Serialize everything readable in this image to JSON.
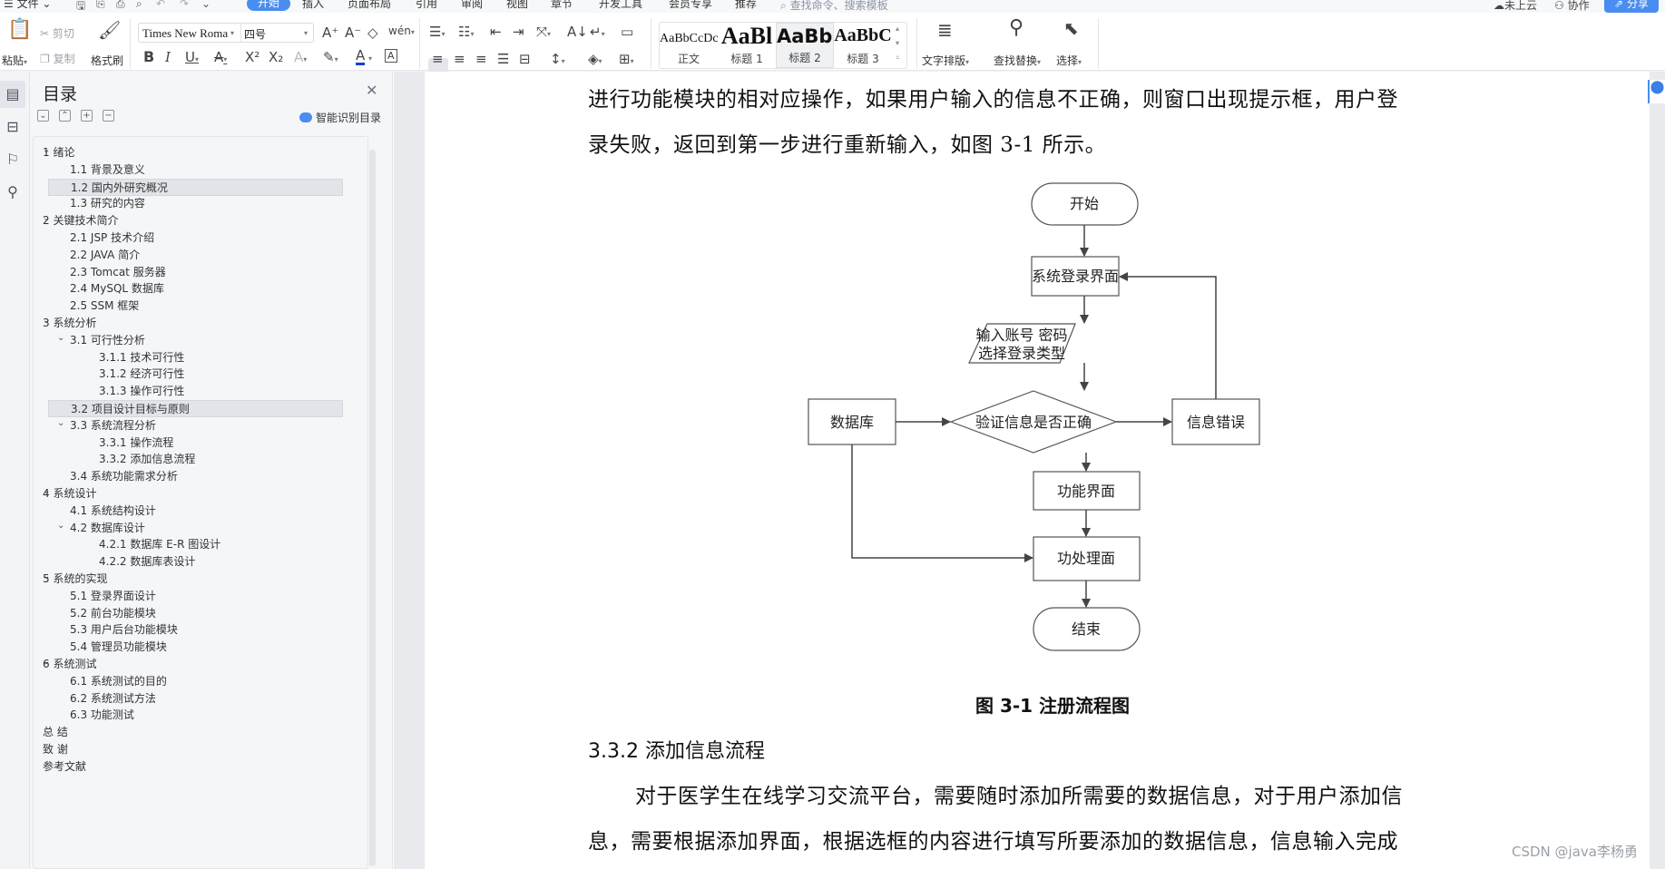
{
  "menubar": {
    "file_menu": "文件",
    "tabs": [
      "开始",
      "插入",
      "页面布局",
      "引用",
      "审阅",
      "视图",
      "章节",
      "开发工具",
      "会员专享",
      "推荐"
    ],
    "active_tab": "开始",
    "search_placeholder": "查找命令、搜索模板",
    "cloud_status": "未上云",
    "collaborate": "协作",
    "share": "分享"
  },
  "ribbon": {
    "paste": "粘贴",
    "cut": "剪切",
    "copy": "复制",
    "format_painter": "格式刷",
    "font_name": "Times New Roma",
    "font_size": "四号",
    "styles": [
      {
        "preview": "AaBbCcDc",
        "label": "正文"
      },
      {
        "preview": "AaBl",
        "label": "标题 1"
      },
      {
        "preview": "AaBb(",
        "label": "标题 2"
      },
      {
        "preview": "AaBbC",
        "label": "标题 3"
      }
    ],
    "selected_style": "标题 2",
    "text_layout": "文字排版",
    "find_replace": "查找替换",
    "select": "选择",
    "pinyin_glyph": "wén"
  },
  "toc": {
    "title": "目录",
    "smart_toc": "智能识别目录",
    "items": [
      {
        "level": 1,
        "label": "1  绪论",
        "expanded": true
      },
      {
        "level": 2,
        "label": "1.1 背景及意义"
      },
      {
        "level": 2,
        "label": "1.2  国内外研究概况",
        "highlighted": true
      },
      {
        "level": 2,
        "label": "1.3  研究的内容"
      },
      {
        "level": 1,
        "label": "2  关键技术简介",
        "expanded": true
      },
      {
        "level": 2,
        "label": "2.1 JSP 技术介绍"
      },
      {
        "level": 2,
        "label": "2.2 JAVA 简介"
      },
      {
        "level": 2,
        "label": "2.3 Tomcat 服务器"
      },
      {
        "level": 2,
        "label": "2.4 MySQL 数据库"
      },
      {
        "level": 2,
        "label": "2.5 SSM 框架"
      },
      {
        "level": 1,
        "label": "3  系统分析",
        "expanded": true
      },
      {
        "level": 2,
        "label": "3.1  可行性分析",
        "expanded": true
      },
      {
        "level": 3,
        "label": "3.1.1  技术可行性"
      },
      {
        "level": 3,
        "label": "3.1.2  经济可行性"
      },
      {
        "level": 3,
        "label": "3.1.3  操作可行性"
      },
      {
        "level": 2,
        "label": "3.2  项目设计目标与原则",
        "highlighted": true
      },
      {
        "level": 2,
        "label": "3.3  系统流程分析",
        "expanded": true
      },
      {
        "level": 3,
        "label": "3.3.1  操作流程"
      },
      {
        "level": 3,
        "label": "3.3.2  添加信息流程"
      },
      {
        "level": 2,
        "label": "3.4  系统功能需求分析"
      },
      {
        "level": 1,
        "label": "4  系统设计",
        "expanded": true
      },
      {
        "level": 2,
        "label": "4.1 系统结构设计"
      },
      {
        "level": 2,
        "label": "4.2 数据库设计",
        "expanded": true
      },
      {
        "level": 3,
        "label": "4.2.1  数据库 E-R 图设计"
      },
      {
        "level": 3,
        "label": "4.2.2  数据库表设计"
      },
      {
        "level": 1,
        "label": "5  系统的实现",
        "expanded": true
      },
      {
        "level": 2,
        "label": "5.1 登录界面设计"
      },
      {
        "level": 2,
        "label": "5.2 前台功能模块"
      },
      {
        "level": 2,
        "label": "5.3 用户后台功能模块"
      },
      {
        "level": 2,
        "label": "5.4 管理员功能模块"
      },
      {
        "level": 1,
        "label": "6  系统测试",
        "expanded": true
      },
      {
        "level": 2,
        "label": "6.1 系统测试的目的"
      },
      {
        "level": 2,
        "label": "6.2 系统测试方法"
      },
      {
        "level": 2,
        "label": "6.3 功能测试"
      },
      {
        "level": 0,
        "label": "总 结"
      },
      {
        "level": 0,
        "label": "致 谢"
      },
      {
        "level": 0,
        "label": "参考文献"
      }
    ]
  },
  "document": {
    "para1_line1": "进行功能模块的相对应操作，如果用户输入的信息不正确，则窗口出现提示框，用户登",
    "para1_line2": "录失败，返回到第一步进行重新输入，如图 3-1 所示。",
    "flowchart": {
      "start": "开始",
      "login_ui": "系统登录界面",
      "input_line1": "输入账号 密码",
      "input_line2": "选择登录类型",
      "verify": "验证信息是否正确",
      "database": "数据库",
      "error": "信息错误",
      "function_ui": "功能界面",
      "process_ui": "功处理面",
      "end": "结束"
    },
    "figure_caption": "图 3-1 注册流程图",
    "section_heading": "3.3.2  添加信息流程",
    "para2_line1": "对于医学生在线学习交流平台，需要随时添加所需要的数据信息，对于用户添加信",
    "para2_line2": "息，需要根据添加界面，根据选框的内容进行填写所要添加的数据信息，信息输入完成"
  },
  "watermark": "CSDN @java李杨勇"
}
